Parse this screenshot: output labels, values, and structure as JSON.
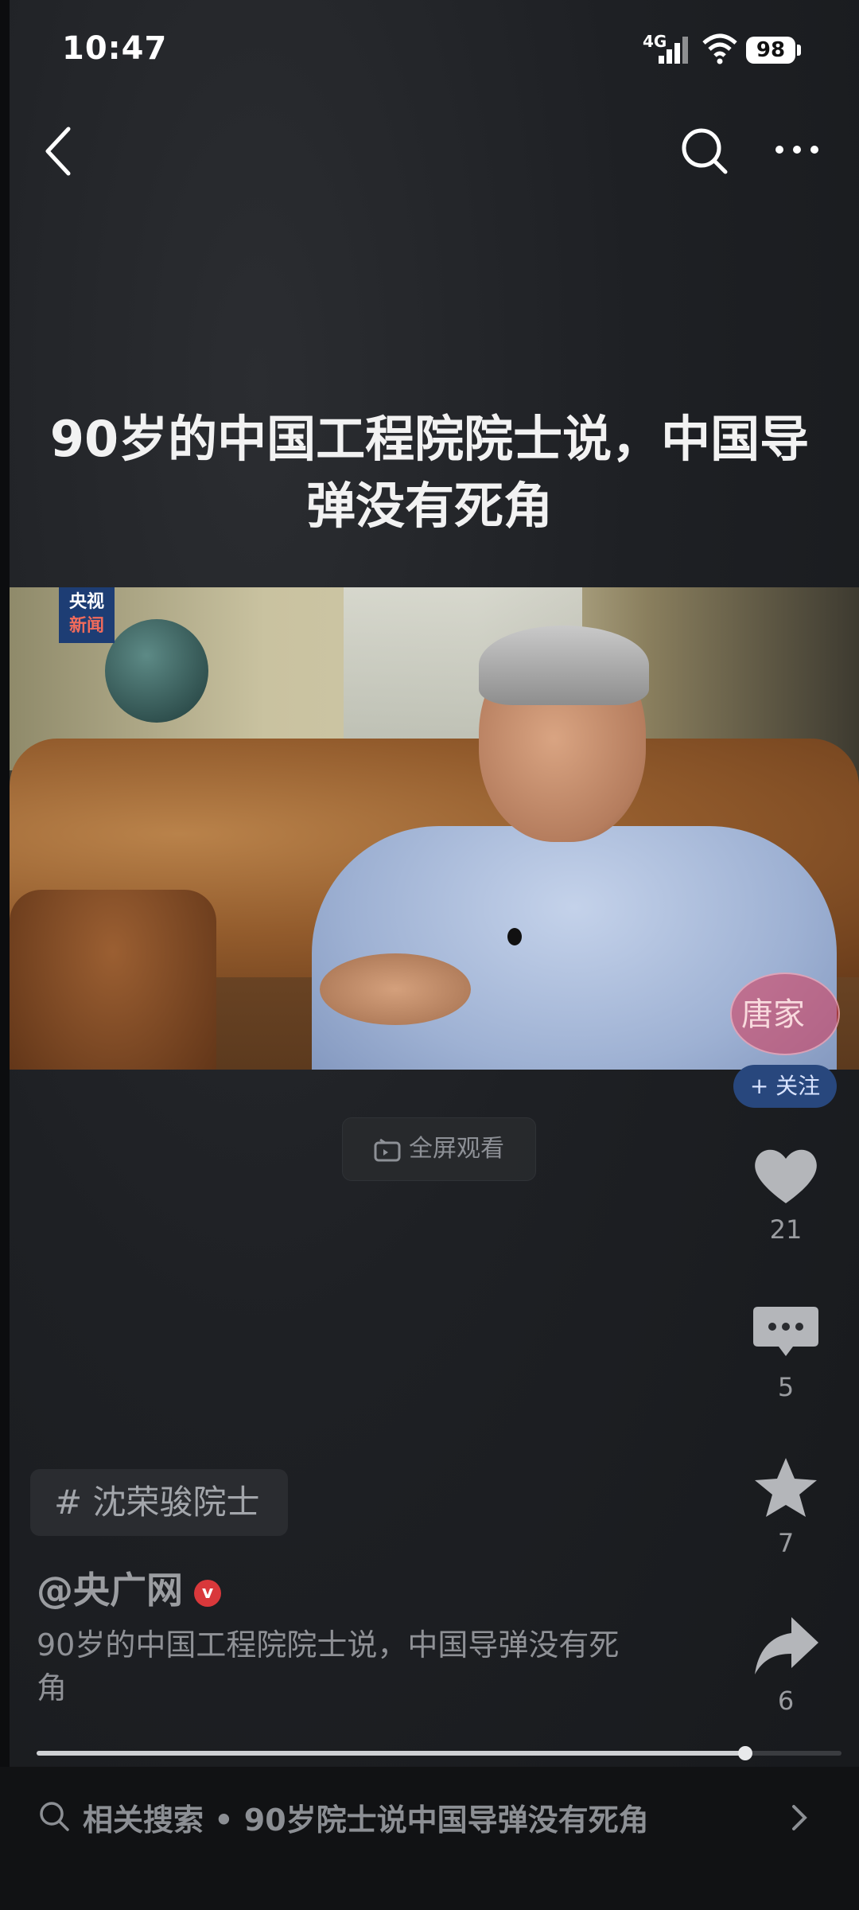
{
  "status_bar": {
    "time": "10:47",
    "network": "4G",
    "battery": "98"
  },
  "headline": "90岁的中国工程院院士说，中国导弹没有死角",
  "video": {
    "logo_line1": "央视",
    "logo_line2": "新闻",
    "stamp_text": "唐家",
    "follow_label": "+ 关注",
    "fullscreen_label": "全屏观看"
  },
  "actions": {
    "likes": "21",
    "comments": "5",
    "favorites": "7",
    "shares": "6"
  },
  "topic": "# 沈荣骏院士",
  "author": "@央广网",
  "description": "90岁的中国工程院院士说，中国导弹没有死角",
  "progress": 0.88,
  "related_search": "相关搜索 • 90岁院士说中国导弹没有死角",
  "colors": {
    "accent_blue": "#28477d",
    "verify_red": "#d9383b"
  }
}
